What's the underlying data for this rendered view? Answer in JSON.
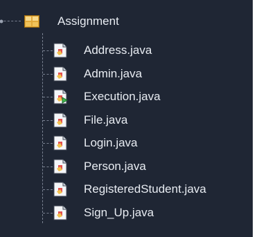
{
  "tree": {
    "root": {
      "label": "Assignment",
      "icon": "package-icon",
      "expanded": true
    },
    "files": [
      {
        "label": "Address.java",
        "icon": "java-file-icon"
      },
      {
        "label": "Admin.java",
        "icon": "java-file-icon"
      },
      {
        "label": "Execution.java",
        "icon": "java-main-file-icon"
      },
      {
        "label": "File.java",
        "icon": "java-file-icon"
      },
      {
        "label": "Login.java",
        "icon": "java-file-icon"
      },
      {
        "label": "Person.java",
        "icon": "java-file-icon"
      },
      {
        "label": "RegisteredStudent.java",
        "icon": "java-file-icon"
      },
      {
        "label": "Sign_Up.java",
        "icon": "java-file-icon"
      }
    ]
  },
  "colors": {
    "background": "#1f2634",
    "text": "#e8ecf2",
    "tree_lines": "#7a8292",
    "package_icon": "#e2a93a",
    "run_badge": "#3fb34f"
  }
}
